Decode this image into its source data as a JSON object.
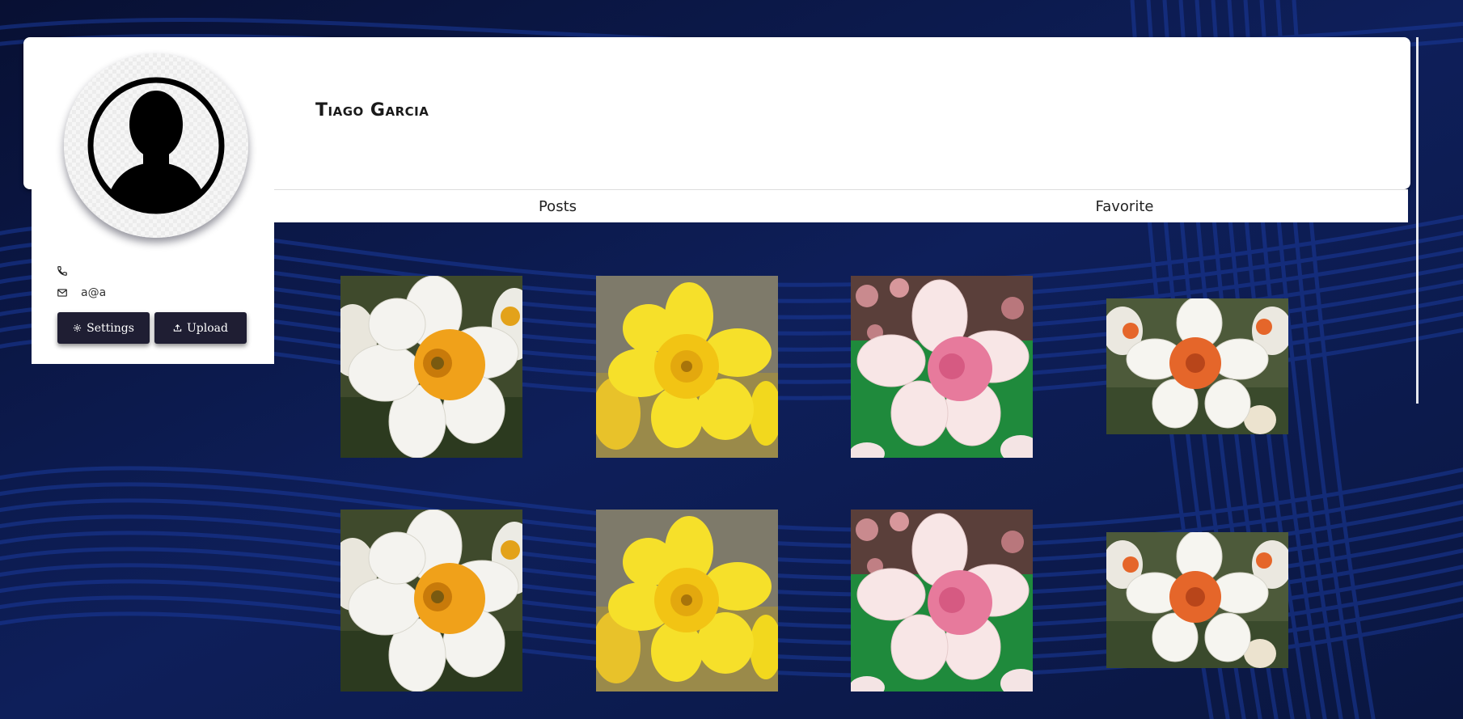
{
  "profile": {
    "name": "Tiago Garcia",
    "phone": "",
    "email": "a@a"
  },
  "actions": {
    "settings_label": "Settings",
    "upload_label": "Upload"
  },
  "tabs": [
    {
      "label": "Posts"
    },
    {
      "label": "Favorite"
    }
  ],
  "gallery": {
    "images": [
      {
        "kind": "white-daffodil-orange-cup"
      },
      {
        "kind": "yellow-daffodil"
      },
      {
        "kind": "pink-cup-daffodil"
      },
      {
        "kind": "white-daffodil-coral-cup"
      },
      {
        "kind": "white-daffodil-orange-cup"
      },
      {
        "kind": "yellow-daffodil"
      },
      {
        "kind": "pink-cup-daffodil"
      },
      {
        "kind": "white-daffodil-coral-cup"
      }
    ]
  },
  "icons": {
    "phone": "phone-icon",
    "email": "mail-icon",
    "settings": "gear-icon",
    "upload": "upload-icon",
    "avatar": "user-silhouette-icon"
  },
  "colors": {
    "background": "#0b1740",
    "button": "#1f1e33",
    "card": "#ffffff"
  }
}
